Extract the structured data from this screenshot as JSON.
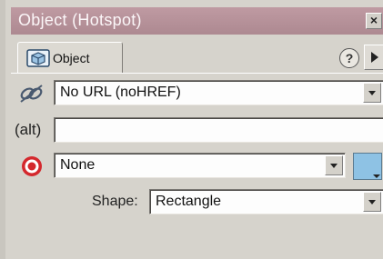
{
  "window": {
    "title": "Object (Hotspot)",
    "close_glyph": "×"
  },
  "tab": {
    "label": "Object",
    "icon": "hotspot-object-icon"
  },
  "help": {
    "glyph": "?"
  },
  "link": {
    "icon": "link-icon",
    "value": "No URL (noHREF)"
  },
  "alt": {
    "label": "(alt)",
    "value": ""
  },
  "target": {
    "icon": "target-icon",
    "value": "None",
    "swatch_color": "#8ec2e4"
  },
  "shape": {
    "label": "Shape:",
    "value": "Rectangle"
  },
  "colors": {
    "titlebar": "#b8939b",
    "panel": "#d6d3cc",
    "target_red": "#d4282d"
  }
}
